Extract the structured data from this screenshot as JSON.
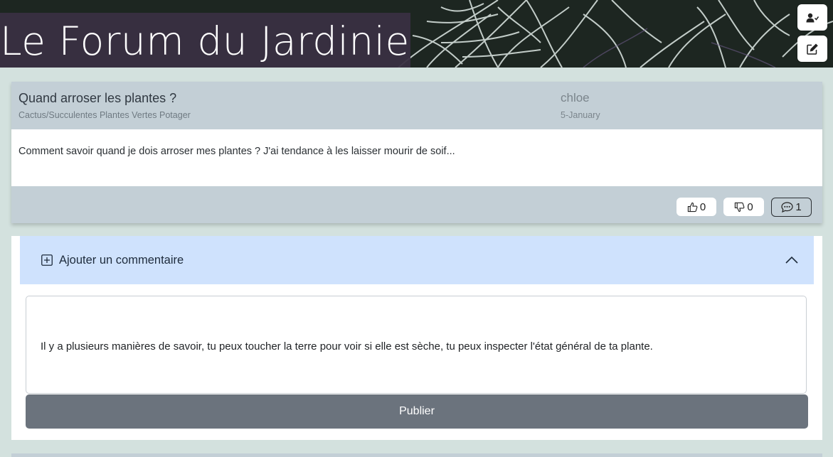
{
  "header": {
    "site_title": "Le Forum du Jardinier",
    "user_button_icon": "user-check-icon",
    "new_post_button_icon": "edit-square-icon"
  },
  "post": {
    "title": "Quand arroser les plantes ?",
    "tags": "Cactus/Succulentes Plantes Vertes Potager",
    "author": "chloe",
    "date": "5-January",
    "body": "Comment savoir quand je dois arroser mes plantes ? J'ai tendance à les laisser mourir de soif...",
    "likes": "0",
    "dislikes": "0",
    "comments": "1"
  },
  "comment_form": {
    "toggle_label": "Ajouter un commentaire",
    "text": "Il y a plusieurs manières de savoir, tu peux toucher la terre pour voir si elle est sèche, tu peux inspecter l'état général de ta plante.",
    "publish_label": "Publier"
  },
  "colors": {
    "background": "#d3e1de",
    "card": "#c3cfd6",
    "accordion": "#cfe2fd",
    "publish_button": "#6b737d",
    "title_backdrop": "#392f42"
  }
}
